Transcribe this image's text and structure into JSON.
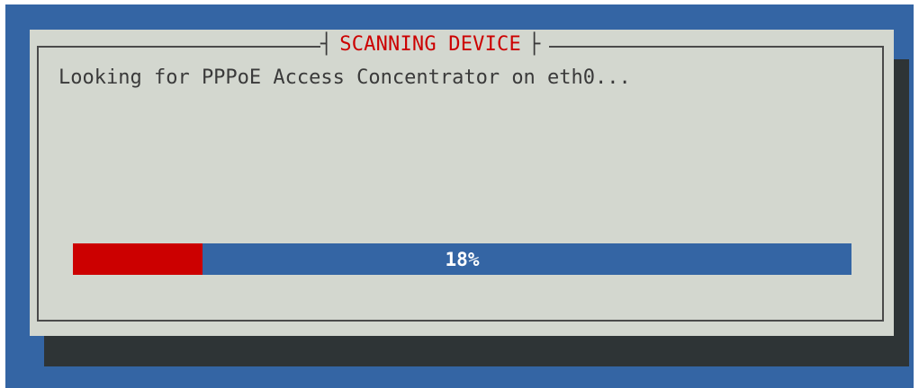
{
  "dialog": {
    "title": "SCANNING DEVICE",
    "message": "Looking for PPPoE Access Concentrator on eth0...",
    "progress": {
      "value": 0.167,
      "label": "18%"
    }
  },
  "colors": {
    "background": "#3465a4",
    "dialog": "#d3d7cf",
    "shadow": "#2e3436",
    "title": "#cc0000",
    "progress_fill": "#cc0000",
    "progress_track": "#3465a4"
  }
}
